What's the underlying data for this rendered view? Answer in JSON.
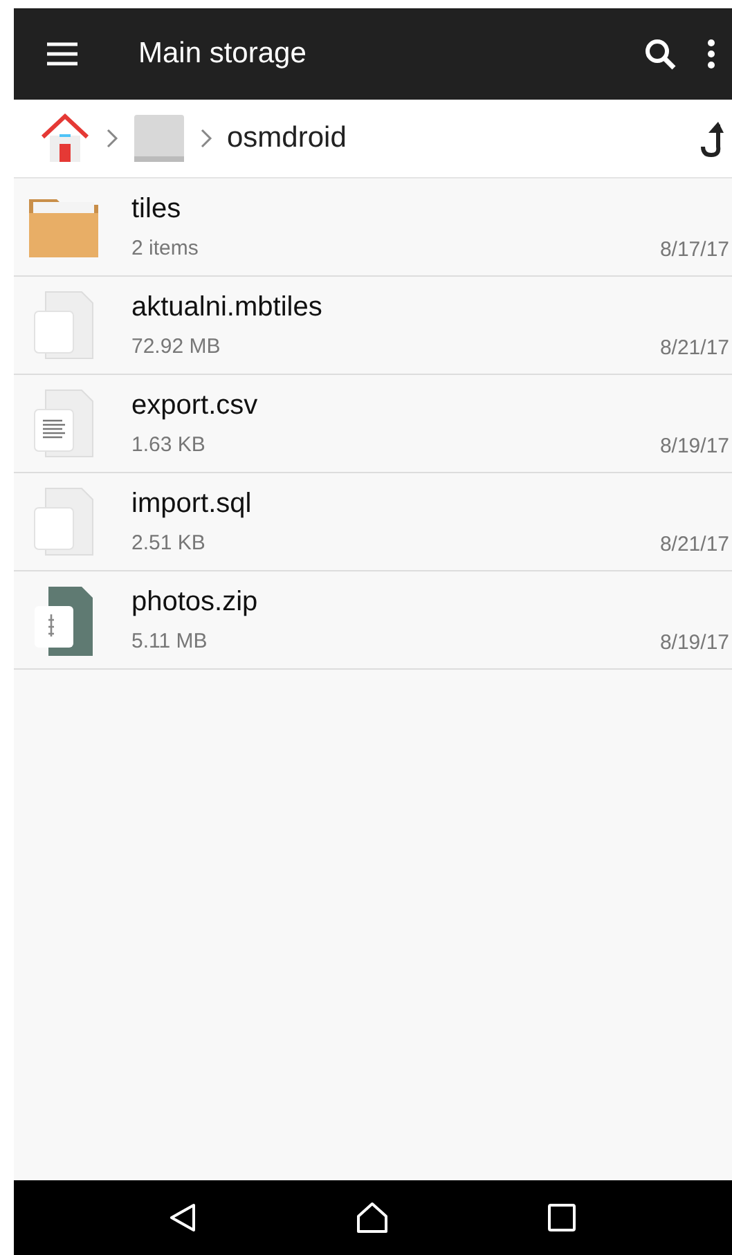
{
  "toolbar": {
    "title": "Main storage"
  },
  "breadcrumb": {
    "current": "osmdroid"
  },
  "files": [
    {
      "kind": "folder",
      "name": "tiles",
      "detail": "2 items",
      "date": "8/17/17"
    },
    {
      "kind": "blank",
      "name": "aktualni.mbtiles",
      "detail": "72.92 MB",
      "date": "8/21/17"
    },
    {
      "kind": "text",
      "name": "export.csv",
      "detail": "1.63 KB",
      "date": "8/19/17"
    },
    {
      "kind": "blank",
      "name": "import.sql",
      "detail": "2.51 KB",
      "date": "8/21/17"
    },
    {
      "kind": "zip",
      "name": "photos.zip",
      "detail": "5.11 MB",
      "date": "8/19/17"
    }
  ]
}
